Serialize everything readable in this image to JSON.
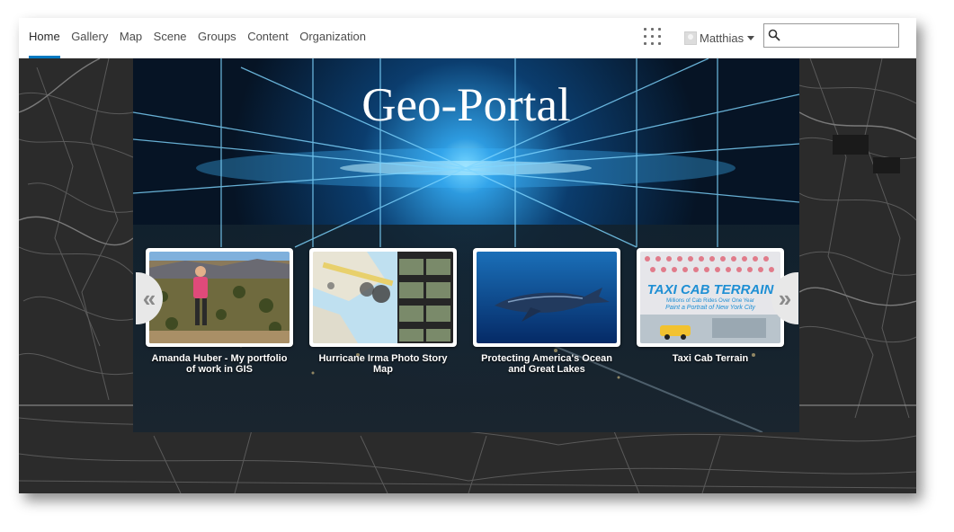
{
  "nav": {
    "items": [
      {
        "label": "Home",
        "active": true
      },
      {
        "label": "Gallery",
        "active": false
      },
      {
        "label": "Map",
        "active": false
      },
      {
        "label": "Scene",
        "active": false
      },
      {
        "label": "Groups",
        "active": false
      },
      {
        "label": "Content",
        "active": false
      },
      {
        "label": "Organization",
        "active": false
      }
    ],
    "user_name": "Matthias",
    "search_value": "",
    "accent_color": "#0079c1"
  },
  "banner": {
    "title": "Geo-Portal"
  },
  "carousel": {
    "prev_glyph": "«",
    "next_glyph": "»",
    "items": [
      {
        "caption": "Amanda Huber - My portfolio of work in GIS",
        "thumb": "hiker-photo"
      },
      {
        "caption": "Hurricane Irma Photo Story Map",
        "thumb": "story-map-screenshot"
      },
      {
        "caption": "Protecting America's Ocean and Great Lakes",
        "thumb": "whale-photo"
      },
      {
        "caption": "Taxi Cab Terrain",
        "thumb": "taxi-cab-terrain-graphic",
        "thumb_title": "TAXI CAB TERRAIN",
        "thumb_subtitle_1": "Millions of Cab Rides Over One Year",
        "thumb_subtitle_2": "Paint a Portrait of New York City"
      }
    ]
  }
}
